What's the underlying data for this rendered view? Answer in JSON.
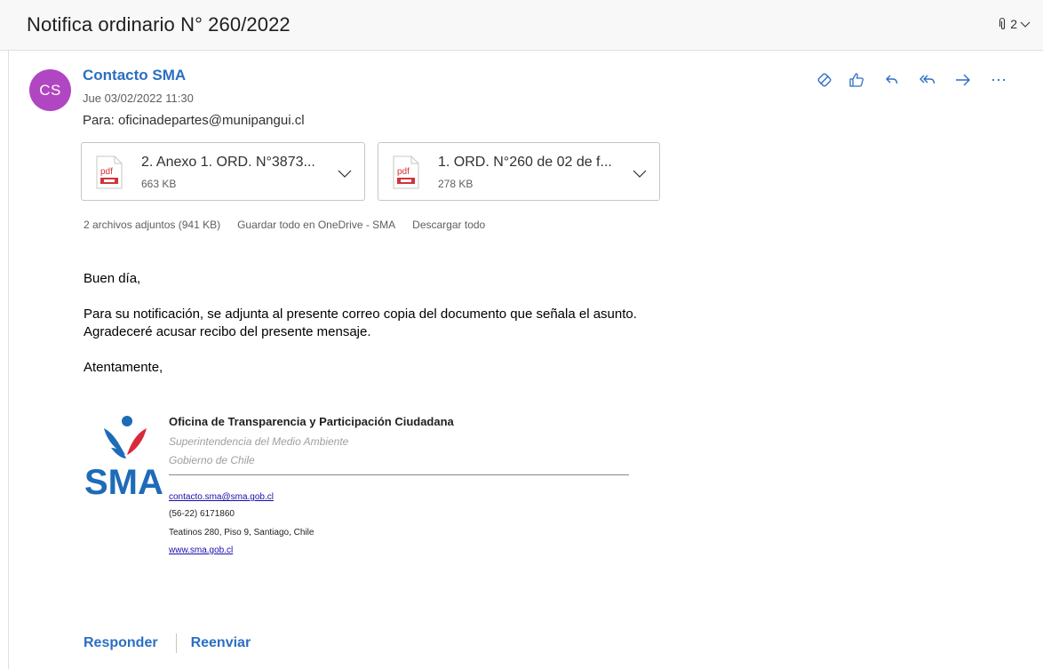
{
  "email": {
    "subject": "Notifica ordinario N° 260/2022",
    "attachment_count": "2",
    "sender": {
      "initials": "CS",
      "avatar_color": "#b146c2",
      "name": "Contacto SMA",
      "date": "Jue 03/02/2022 11:30"
    },
    "to_line": "Para: oficinadepartes@munipangui.cl",
    "actions": [
      "sensitivity-icon",
      "like-icon",
      "reply-icon",
      "reply-all-icon",
      "forward-icon",
      "more-icon"
    ],
    "attachments": [
      {
        "name": "2. Anexo 1. ORD. N°3873...",
        "size": "663 KB",
        "icon": "pdf-icon"
      },
      {
        "name": "1. ORD. N°260 de 02 de f...",
        "size": "278 KB",
        "icon": "pdf-icon"
      }
    ],
    "attachment_summary": {
      "total": "2 archivos adjuntos (941 KB)",
      "save_all": "Guardar todo en OneDrive - SMA",
      "download_all": "Descargar todo"
    },
    "body": {
      "greeting": "Buen día,",
      "line1": "Para su notificación, se adjunta al presente correo copia del documento que señala el asunto.",
      "line2": "Agradeceré acusar recibo del presente mensaje.",
      "closing": "Atentamente,"
    },
    "signature": {
      "logo_text": "SMA",
      "org": "Oficina de Transparencia y Participación Ciudadana",
      "sub1": "Superintendencia del Medio Ambiente",
      "sub2": "Gobierno de Chile",
      "email": "contacto.sma@sma.gob.cl",
      "phone": "(56-22) 6171860",
      "address": "Teatinos 280, Piso 9, Santiago, Chile",
      "website": "www.sma.gob.cl"
    },
    "footer": {
      "reply": "Responder",
      "forward": "Reenviar"
    },
    "colors": {
      "accent": "#2b6fc2",
      "pdf_red": "#d13438",
      "logo_blue": "#1e6bb8",
      "logo_red": "#d9283a"
    }
  }
}
